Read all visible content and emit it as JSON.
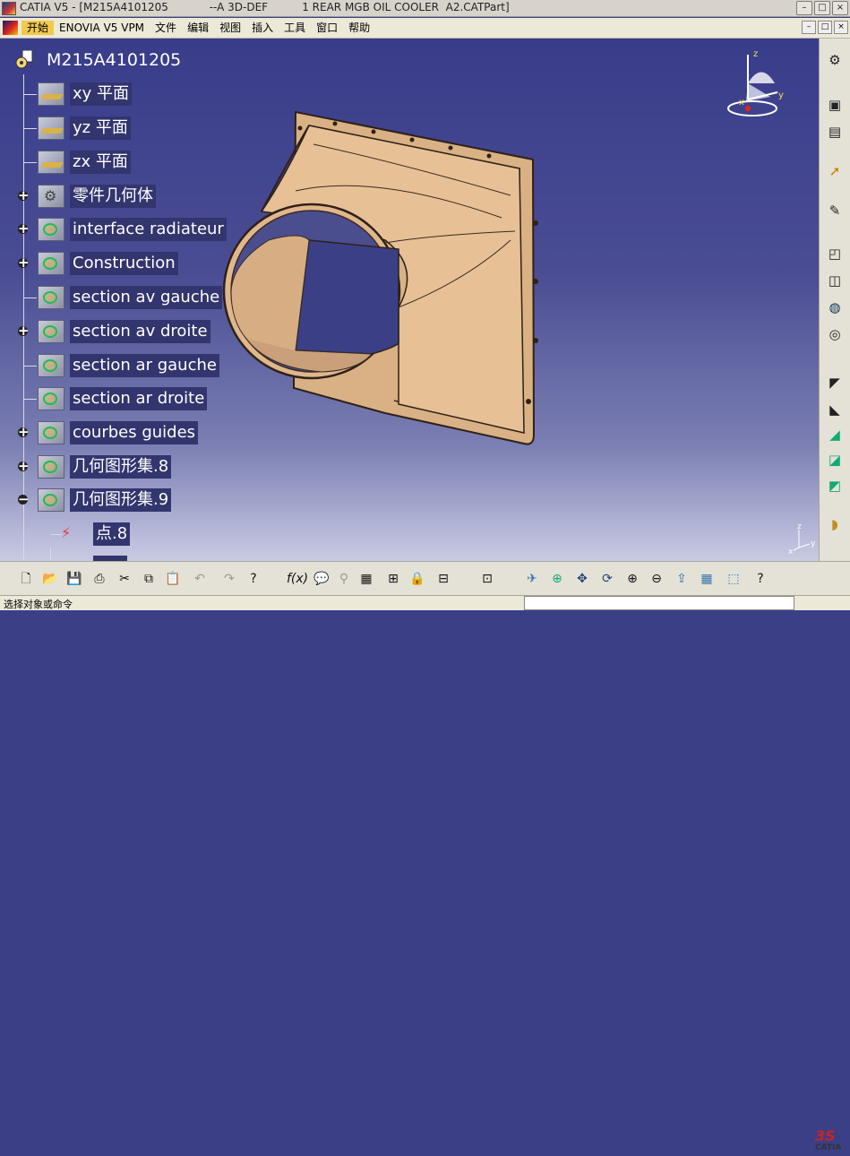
{
  "window": {
    "title": "CATIA V5 - [M215A4101205            --A 3D-DEF          1 REAR MGB OIL COOLER  A2.CATPart]"
  },
  "menu": {
    "items": [
      "开始",
      "ENOVIA V5 VPM",
      "文件",
      "编辑",
      "视图",
      "插入",
      "工具",
      "窗口",
      "帮助"
    ]
  },
  "tree": {
    "root": "M215A4101205",
    "nodes": [
      {
        "label": "xy 平面",
        "icon": "plane-icon"
      },
      {
        "label": "yz 平面",
        "icon": "plane-icon"
      },
      {
        "label": "zx 平面",
        "icon": "plane-icon"
      },
      {
        "label": "零件几何体",
        "icon": "part-body-icon"
      },
      {
        "label": "interface radiateur",
        "icon": "geometrical-set-icon"
      },
      {
        "label": "Construction",
        "icon": "geometrical-set-icon"
      },
      {
        "label": "section av gauche",
        "icon": "geometrical-set-icon"
      },
      {
        "label": "section av droite",
        "icon": "geometrical-set-icon"
      },
      {
        "label": "section ar gauche",
        "icon": "geometrical-set-icon"
      },
      {
        "label": "section ar droite",
        "icon": "geometrical-set-icon"
      },
      {
        "label": "courbes guides",
        "icon": "geometrical-set-icon"
      },
      {
        "label": "几何图形集.8",
        "icon": "geometrical-set-icon"
      },
      {
        "label": "几何图形集.9",
        "icon": "geometrical-set-icon"
      }
    ],
    "child": {
      "label": "点.8",
      "icon": "point-icon"
    }
  },
  "compass": {
    "x_label": "x",
    "y_label": "y",
    "z_label": "z"
  },
  "axis_mini": {
    "x_label": "x",
    "y_label": "y",
    "z_label": "z"
  },
  "status": {
    "message": "选择对象或命令"
  },
  "logo": {
    "text": "CATIA"
  },
  "colors": {
    "part": "#e1b98e",
    "part_edge": "#3a2a20",
    "tree_label_bg": "#32356e",
    "active_menu": "#f2c94c"
  }
}
